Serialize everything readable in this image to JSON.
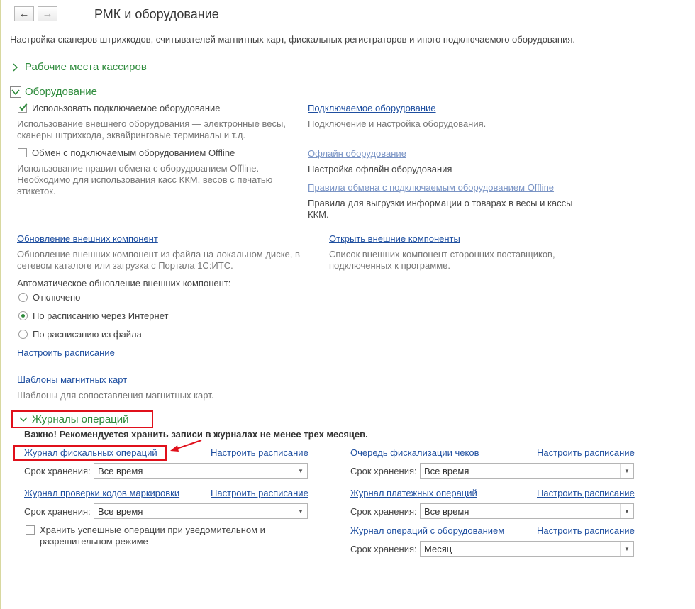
{
  "window": {
    "title": "РМК и оборудование",
    "description": "Настройка сканеров штрихкодов, считывателей магнитных карт, фискальных регистраторов и иного подключаемого оборудования."
  },
  "groups": {
    "cashier": {
      "title": "Рабочие места кассиров"
    },
    "equipment": {
      "title": "Оборудование",
      "use_equipment": {
        "label": "Использовать подключаемое оборудование",
        "checked": true,
        "note": "Использование внешнего оборудования — электронные весы, сканеры штрихкода, эквайринговые терминалы и т.д."
      },
      "connected_equipment": {
        "link": "Подключаемое оборудование",
        "note": "Подключение и настройка оборудования."
      },
      "offline_exchange": {
        "label": "Обмен с подключаемым оборудованием Offline",
        "checked": false,
        "note": "Использование правил обмена с оборудованием Offline. Необходимо для использования касс ККМ, весов с печатью этикеток."
      },
      "offline_equipment": {
        "link": "Офлайн оборудование",
        "note": "Настройка офлайн оборудования"
      },
      "offline_rules": {
        "link": "Правила обмена с подключаемым оборудованием Offline",
        "note": "Правила для выгрузки информации о товарах в весы и кассы ККМ."
      },
      "update_components": {
        "link": "Обновление внешних компонент",
        "note": "Обновление внешних компонент из файла на локальном диске, в сетевом каталоге или загрузка с Портала 1С:ИТС."
      },
      "open_components": {
        "link": "Открыть внешние компоненты",
        "note": "Список внешних компонент сторонних поставщиков, подключенных к программе."
      },
      "auto_update": {
        "label": "Автоматическое обновление внешних компонент:",
        "options": [
          "Отключено",
          "По расписанию через Интернет",
          "По расписанию из файла"
        ],
        "selected": "По расписанию через Интернет"
      },
      "schedule_link": "Настроить расписание",
      "magnetic_templates": {
        "link": "Шаблоны магнитных карт",
        "note": "Шаблоны для сопоставления магнитных карт."
      }
    },
    "journals": {
      "title": "Журналы операций",
      "warning": "Важно! Рекомендуется хранить записи в журналах не менее трех месяцев.",
      "retention_label": "Срок хранения:",
      "schedule_label": "Настроить расписание",
      "items": [
        {
          "title": "Журнал фискальных операций",
          "value": "Все время"
        },
        {
          "title": "Журнал проверки кодов маркировки",
          "value": "Все время"
        },
        {
          "title": "Очередь фискализации чеков",
          "value": "Все время"
        },
        {
          "title": "Журнал платежных операций",
          "value": "Все время"
        },
        {
          "title": "Журнал операций с оборудованием",
          "value": "Месяц"
        }
      ],
      "keep_success": {
        "label": "Хранить успешные операции при уведомительном и разрешительном режиме",
        "checked": false
      }
    }
  },
  "colors": {
    "accent_green": "#2e8b3c",
    "link_blue": "#1f4fa0",
    "highlight_red": "#e0101b"
  }
}
